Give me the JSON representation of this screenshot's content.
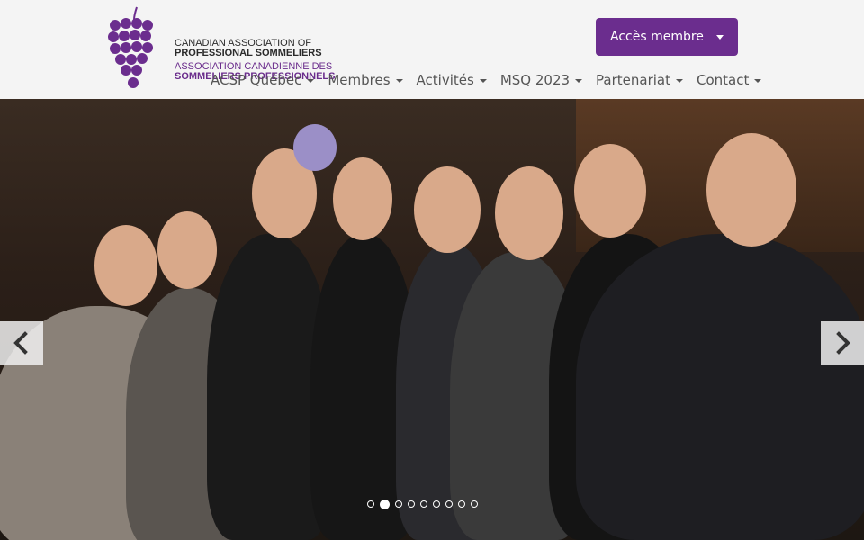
{
  "logo": {
    "en_line1": "CANADIAN ASSOCIATION OF",
    "en_line2": "PROFESSIONAL SOMMELIERS",
    "fr_line1": "ASSOCIATION CANADIENNE DES",
    "fr_line2": "SOMMELIERS PROFESSIONNELS"
  },
  "member_button": {
    "label": "Accès membre"
  },
  "nav": {
    "items": [
      {
        "label": "ACSP Québec"
      },
      {
        "label": "Membres"
      },
      {
        "label": "Activités"
      },
      {
        "label": "MSQ 2023"
      },
      {
        "label": "Partenariat"
      },
      {
        "label": "Contact"
      }
    ]
  },
  "carousel": {
    "slide_count": 9,
    "active_index": 1,
    "prev_icon": "chevron-left-icon",
    "next_icon": "chevron-right-icon"
  },
  "colors": {
    "brand": "#6b2d8e",
    "header_bg": "#f4f4f4"
  }
}
